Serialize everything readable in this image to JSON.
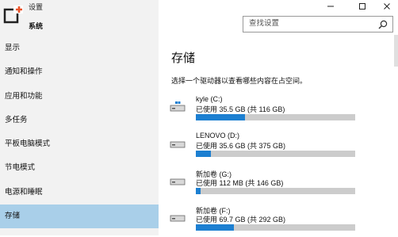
{
  "app": {
    "title": "设置"
  },
  "window_controls": {
    "minimize": "—",
    "maximize": "☐",
    "close": "✕"
  },
  "sidebar": {
    "section_title": "系统",
    "items": [
      {
        "label": "显示",
        "active": false
      },
      {
        "label": "通知和操作",
        "active": false
      },
      {
        "label": "应用和功能",
        "active": false
      },
      {
        "label": "多任务",
        "active": false
      },
      {
        "label": "平板电脑模式",
        "active": false
      },
      {
        "label": "节电模式",
        "active": false
      },
      {
        "label": "电源和睡眠",
        "active": false
      },
      {
        "label": "存储",
        "active": true
      }
    ]
  },
  "search": {
    "placeholder": "查找设置"
  },
  "main": {
    "title": "存储",
    "subtitle": "选择一个驱动器以查看哪些内容在占空间。",
    "drives": [
      {
        "name": "kyle (C:)",
        "usage": "已使用 35.5 GB (共 116 GB)",
        "used_fraction": 0.306
      },
      {
        "name": "LENOVO (D:)",
        "usage": "已使用 35.6 GB (共 375 GB)",
        "used_fraction": 0.095
      },
      {
        "name": "新加卷 (G:)",
        "usage": "已使用 112 MB (共 146 GB)",
        "used_fraction": 0.01
      },
      {
        "name": "新加卷 (F:)",
        "usage": "已使用 69.7 GB (共 292 GB)",
        "used_fraction": 0.239
      }
    ]
  },
  "colors": {
    "accent": "#1c7fd1",
    "selected": "#a9cfe9",
    "sidebar_bg": "#f2f2f2",
    "bar_bg": "#cccccc"
  }
}
